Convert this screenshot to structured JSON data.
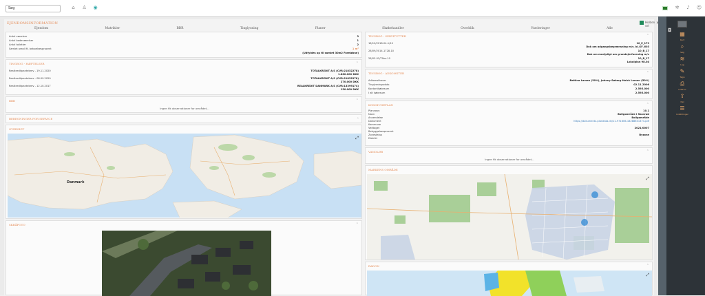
{
  "search": {
    "value": "Søg"
  },
  "header": {
    "title": "EJENDOMSINFORMATION",
    "checkbox_label": "Hidden sel"
  },
  "tabs": [
    "Ejendom",
    "Matrikler",
    "BBR",
    "Tinglysning",
    "Planer",
    "Skøbehandler",
    "Overblik",
    "Vurderinger",
    "Alle"
  ],
  "card_bbr": {
    "rows": [
      {
        "label": "Antal værelser",
        "value": "3"
      },
      {
        "label": "Antal badeværelser",
        "value": "1"
      },
      {
        "label": "Antal toiletter",
        "value": "2"
      },
      {
        "label": "Samlet areal ift. beboelsesprocent",
        "value": "1 m²"
      }
    ],
    "footer": "(Udfyldes op til samlet 30m2 Foreløbne)"
  },
  "card_tinglysning_left": {
    "title": "TINGBOG - HÆFTELSER",
    "rows": [
      {
        "label": "Realkreditpantebrev - 19.11.2020",
        "v1": "TOTALKREDIT A/S (CVR:21832278)",
        "v2": "1.860.000 DKK"
      },
      {
        "label": "Realkreditpantebrev - 08.09.2020",
        "v1": "TOTALKREDIT A/S (CVR:21832278)",
        "v2": "270.000 DKK"
      },
      {
        "label": "Realkreditpantebrev - 12.10.2017",
        "v1": "REALKREDIT DANMARK A/S (CVR:13399174)",
        "v2": "150.000 DKK"
      }
    ]
  },
  "card_bbr2": {
    "title": "BBR",
    "msg": "Ingen fik observationer for området..."
  },
  "card_brt": {
    "title": "BEREGNINGER FOR SERVICE"
  },
  "card_overview_map": {
    "title": "OVERSIGT",
    "label": "Danmark"
  },
  "card_photo": {
    "title": "SKRÅFOTO"
  },
  "card_tingbog_right": {
    "title": "TINGBOG - SERVITUTTER",
    "rows": [
      {
        "label": "18/10/2018-24-1/10",
        "v1": "10_E_179",
        "v2": "Dok om adgangsbegrænsning m/v. bl_KF_603"
      },
      {
        "label": "28/09/2014-1728-10",
        "v1": "10_B_17",
        "v2": "Dok om mod/pligt om grundejerforening m/v"
      },
      {
        "label": "28/05-05/TSes-10",
        "v1": "10_B_17",
        "v2": "Lokalplan 98.04"
      }
    ]
  },
  "card_owners": {
    "title": "TINGBOG - ADKOMSTER",
    "rows": [
      {
        "label": "Adkomsthaver",
        "value": "Bettina Larsen (50%), Johnny Søborg Holck Larsen (50%)"
      },
      {
        "label": "Tinglysningsdato",
        "value": "02.11.2006"
      },
      {
        "label": "Kontantkøbesum",
        "value": "2.595.000"
      },
      {
        "label": "I alt købesum",
        "value": "2.595.000"
      }
    ]
  },
  "card_plan": {
    "title": "KOMMUNEPLAN",
    "rows": [
      {
        "label": "Plannavn",
        "value": "10.1"
      },
      {
        "label": "Navn",
        "value": "Boligområde i Skovrød"
      },
      {
        "label": "Anvendelse",
        "value": "Boligområde"
      },
      {
        "label": "Dokument",
        "value": "https://dokumentx.plandata.dk/11-971606-18288631374.pdf"
      },
      {
        "label": "Kommune",
        "value": ""
      },
      {
        "label": "Vedtaget",
        "value": "2021/0007"
      },
      {
        "label": "Bebyggelsesprocent",
        "value": ""
      },
      {
        "label": "Zonestatus",
        "value": "Byzone"
      },
      {
        "label": "Distrikt",
        "value": ""
      }
    ]
  },
  "card_vand": {
    "title": "VANDLØB",
    "msg": "Ingen fik observationer for området..."
  },
  "card_area_map": {
    "title": "MARKENS OMRÅDE"
  },
  "card_flood": {
    "title": "RADON"
  },
  "sidebar": {
    "items": [
      {
        "label": "Kort"
      },
      {
        "label": "Søg"
      },
      {
        "label": "Lag"
      },
      {
        "label": "Tegn"
      },
      {
        "label": "Udskriv"
      },
      {
        "label": "Del"
      },
      {
        "label": "Indstillinger"
      }
    ]
  },
  "colors": {
    "accent": "#e58b56",
    "sidebar": "#2d3338"
  }
}
